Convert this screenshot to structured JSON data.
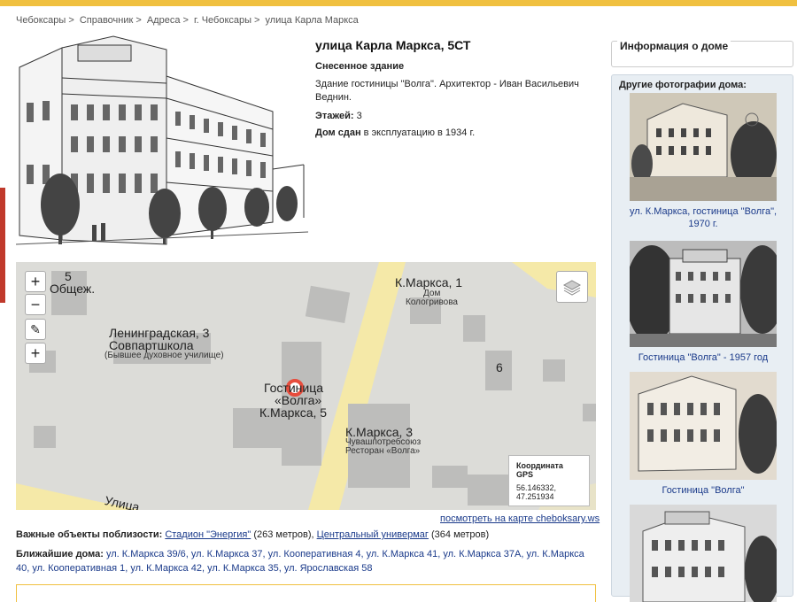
{
  "breadcrumbs": [
    "Чебоксары",
    "Справочник",
    "Адреса",
    "г. Чебоксары",
    "улица Карла Маркса"
  ],
  "breadcrumb_sep": ">",
  "building": {
    "title": "улица Карла Маркса, 5СТ",
    "status": "Снесенное здание",
    "description": "Здание гостиницы \"Волга\". Архитектор - Иван Васильевич Веднин.",
    "floors_label": "Этажей:",
    "floors_value": "3",
    "built_label": "Дом сдан",
    "built_value": "в эксплуатацию в 1934 г."
  },
  "map": {
    "labels": {
      "a": "5",
      "b": "Общеж.",
      "c": "Ленинградская, 3",
      "d": "Совпартшкола",
      "e": "(Бывшее духовное училище)",
      "f": "К.Маркса, 1",
      "g": "Дом",
      "h": "Кологривова",
      "i": "Гостиница",
      "j": "«Волга»",
      "k": "К.Маркса, 5",
      "l": "6",
      "m": "К.Маркса, 3",
      "n": "Чувашпотребсоюз",
      "o": "Ресторан «Волга»",
      "p": "Улица"
    },
    "zoom_in": "+",
    "zoom_out": "−",
    "draw": "✎",
    "add": "+",
    "gps_title": "Координата GPS",
    "gps_coords": "56.146332, 47.251934"
  },
  "map_link": "посмотреть на карте cheboksary.ws",
  "nearby_objects": {
    "label": "Важные объекты поблизости:",
    "items": [
      {
        "name": "Стадион \"Энергия\"",
        "dist": "(263 метров),"
      },
      {
        "name": "Центральный универмаг",
        "dist": "(364 метров)"
      }
    ]
  },
  "nearest_houses": {
    "label": "Ближайшие дома:",
    "items": [
      "ул. К.Маркса 39/6,",
      "ул. К.Маркса 37,",
      "ул. Кооперативная 4,",
      "ул. К.Маркса 41,",
      "ул. К.Маркса 37А,",
      "ул. К.Маркса 40,",
      "ул. Кооперативная 1,",
      "ул. К.Маркса 42,",
      "ул. К.Маркса 35,",
      "ул. Ярославская 58"
    ]
  },
  "sidebar": {
    "info_title": "Информация о доме",
    "photos_title": "Другие фотографии дома:",
    "photos": [
      {
        "caption": "ул. К.Маркса, гостиница \"Волга\", 1970 г."
      },
      {
        "caption": "Гостиница \"Волга\" - 1957 год"
      },
      {
        "caption": "Гостиница \"Волга\""
      }
    ]
  }
}
